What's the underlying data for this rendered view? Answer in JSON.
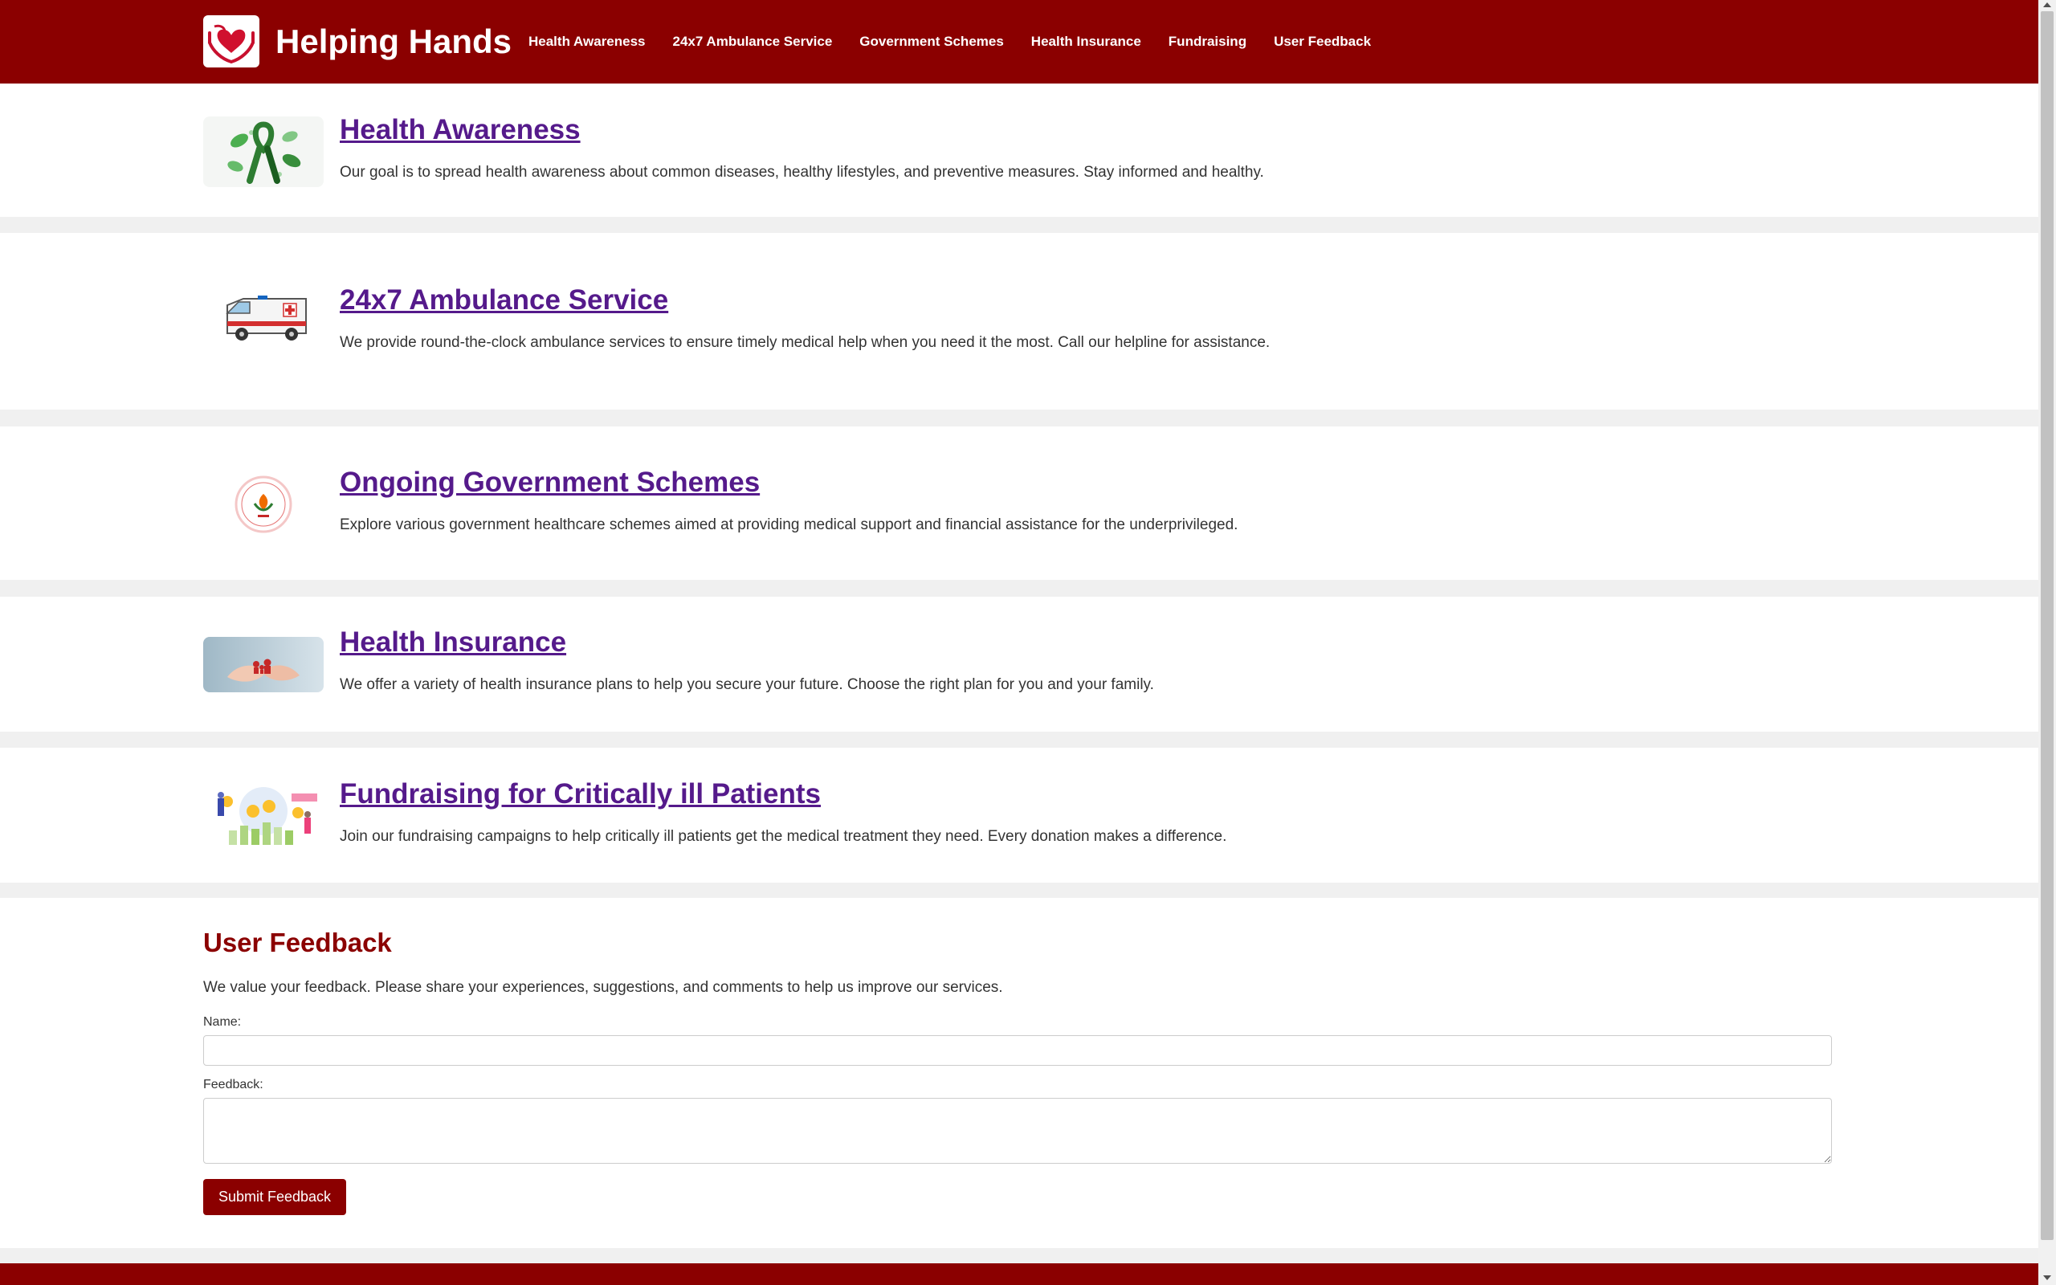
{
  "site": {
    "title": "Helping Hands",
    "logo_icon": "heart-in-hands-icon"
  },
  "nav": [
    {
      "label": "Health Awareness"
    },
    {
      "label": "24x7 Ambulance Service"
    },
    {
      "label": "Government Schemes"
    },
    {
      "label": "Health Insurance"
    },
    {
      "label": "Fundraising"
    },
    {
      "label": "User Feedback"
    }
  ],
  "sections": [
    {
      "title": "Health Awareness",
      "description": "Our goal is to spread health awareness about common diseases, healthy lifestyles, and preventive measures. Stay informed and healthy.",
      "image": "awareness-ribbon-image"
    },
    {
      "title": "24x7 Ambulance Service",
      "description": "We provide round-the-clock ambulance services to ensure timely medical help when you need it the most. Call our helpline for assistance.",
      "image": "ambulance-image"
    },
    {
      "title": "Ongoing Government Schemes",
      "description": "Explore various government healthcare schemes aimed at providing medical support and financial assistance for the underprivileged.",
      "image": "government-scheme-emblem-image"
    },
    {
      "title": "Health Insurance",
      "description": "We offer a variety of health insurance plans to help you secure your future. Choose the right plan for you and your family.",
      "image": "hands-holding-family-image"
    },
    {
      "title": "Fundraising for Critically ill Patients",
      "description": "Join our fundraising campaigns to help critically ill patients get the medical treatment they need. Every donation makes a difference.",
      "image": "fundraising-illustration-image"
    }
  ],
  "feedback": {
    "heading": "User Feedback",
    "intro": "We value your feedback. Please share your experiences, suggestions, and comments to help us improve our services.",
    "name_label": "Name:",
    "name_value": "",
    "feedback_label": "Feedback:",
    "feedback_value": "",
    "submit_label": "Submit Feedback"
  },
  "colors": {
    "brand": "#8b0000",
    "link_visited": "#551a8b",
    "page_bg": "#f0f0f0"
  }
}
